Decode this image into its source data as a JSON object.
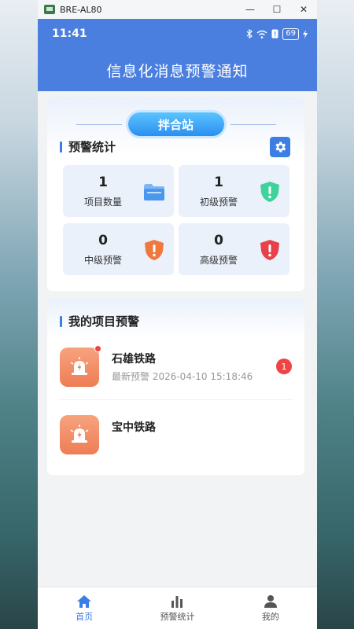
{
  "window": {
    "title": "BRE-AL80",
    "minimize": "—",
    "maximize": "☐",
    "close": "✕"
  },
  "status_bar": {
    "time": "11:41",
    "battery": "69"
  },
  "header": {
    "title": "信息化消息预警通知"
  },
  "station": {
    "label": "拌合站"
  },
  "stats_section": {
    "title": "预警统计",
    "items": [
      {
        "value": "1",
        "label": "项目数量",
        "icon": "folder-icon"
      },
      {
        "value": "1",
        "label": "初级预警",
        "icon": "green-shield-alert-icon"
      },
      {
        "value": "0",
        "label": "中级预警",
        "icon": "orange-shield-alert-icon"
      },
      {
        "value": "0",
        "label": "高级预警",
        "icon": "red-shield-alert-icon"
      }
    ]
  },
  "projects_section": {
    "title": "我的项目预警",
    "projects": [
      {
        "name": "石雄铁路",
        "subtitle": "最新预警 2026-04-10 15:18:46",
        "badge": "1",
        "has_dot": true
      },
      {
        "name": "宝中铁路"
      }
    ]
  },
  "tabs": [
    {
      "label": "首页",
      "icon": "home-icon",
      "active": true
    },
    {
      "label": "预警统计",
      "icon": "bar-chart-icon",
      "active": false
    },
    {
      "label": "我的",
      "icon": "user-icon",
      "active": false
    }
  ],
  "colors": {
    "primary": "#4a7fe0",
    "accent": "#3d7ee6",
    "alert_red": "#ef4444",
    "warning_orange": "#ee7d55"
  }
}
